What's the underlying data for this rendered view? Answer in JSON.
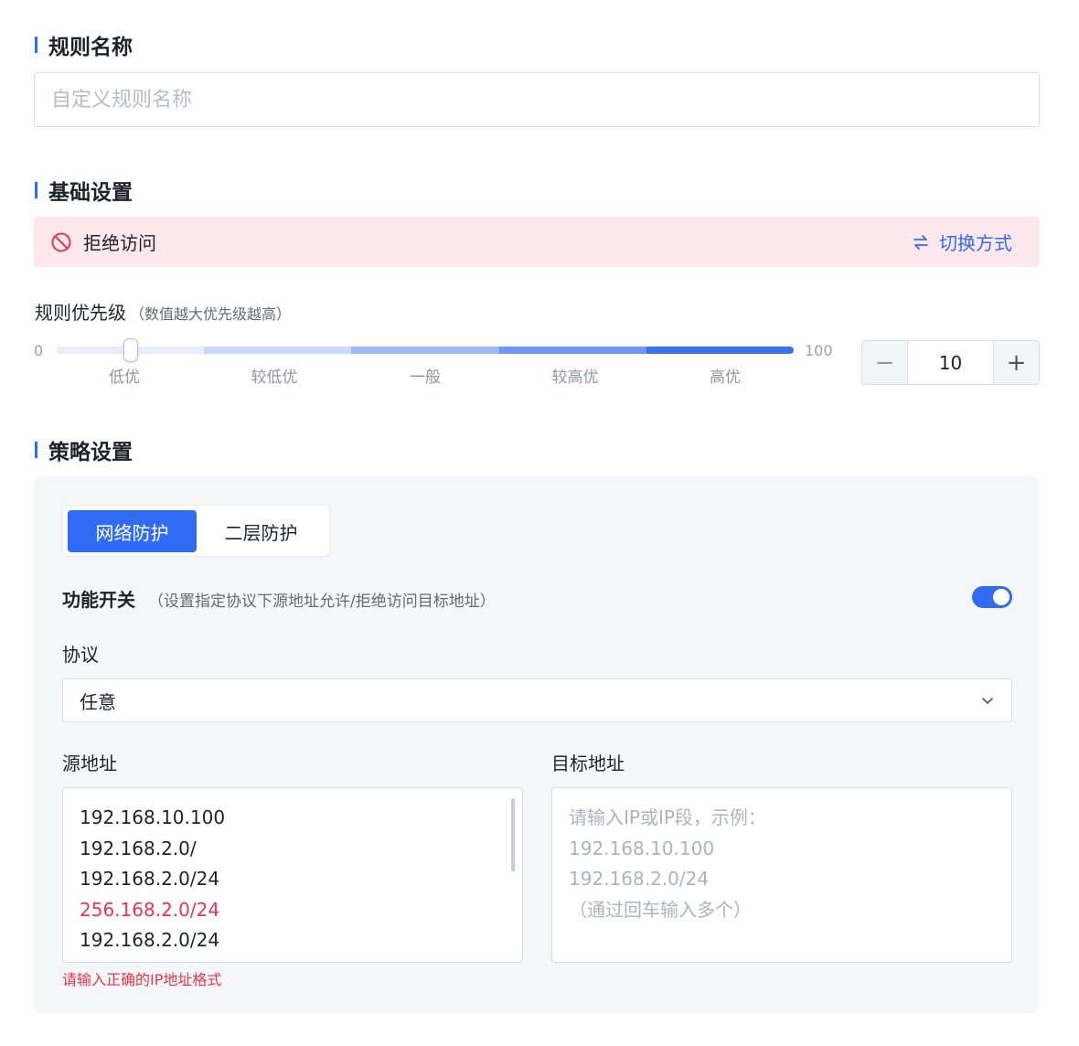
{
  "rule_name": {
    "title": "规则名称",
    "placeholder": "自定义规则名称"
  },
  "basic": {
    "title": "基础设置",
    "action": {
      "label": "拒绝访问",
      "icon": "ban-icon",
      "switch_label": "切换方式",
      "switch_icon": "swap-arrows-icon"
    },
    "priority": {
      "label": "规则优先级",
      "hint": "（数值越大优先级越高）",
      "min_label": "0",
      "max_label": "100",
      "ticks": [
        "低优",
        "较低优",
        "一般",
        "较高优",
        "高优"
      ],
      "value": 10,
      "value_text": "10",
      "minus_symbol": "−",
      "plus_symbol": "+"
    }
  },
  "strategy": {
    "title": "策略设置",
    "tabs": [
      {
        "label": "网络防护",
        "active": true
      },
      {
        "label": "二层防护",
        "active": false
      }
    ],
    "function_switch": {
      "label": "功能开关",
      "hint": "（设置指定协议下源地址允许/拒绝访问目标地址）",
      "enabled": true
    },
    "protocol": {
      "label": "协议",
      "value": "任意"
    },
    "source": {
      "label": "源地址",
      "lines": [
        {
          "text": "192.168.10.100",
          "error": false
        },
        {
          "text": "192.168.2.0/",
          "error": false
        },
        {
          "text": "192.168.2.0/24",
          "error": false
        },
        {
          "text": "256.168.2.0/24",
          "error": true
        },
        {
          "text": "192.168.2.0/24",
          "error": false
        }
      ],
      "error_message": "请输入正确的IP地址格式"
    },
    "target": {
      "label": "目标地址",
      "placeholder_lines": [
        "请输入IP或IP段，示例：",
        "192.168.10.100",
        "192.168.2.0/24",
        "（通过回车输入多个）"
      ]
    }
  },
  "colors": {
    "accent": "#2f6bf5",
    "error": "#e8344e",
    "deny_background": "#fce8ec",
    "slider_segments": [
      "#e8eefc",
      "#c9d8fb",
      "#9db9f8",
      "#6e98f6",
      "#3a72f4"
    ]
  }
}
